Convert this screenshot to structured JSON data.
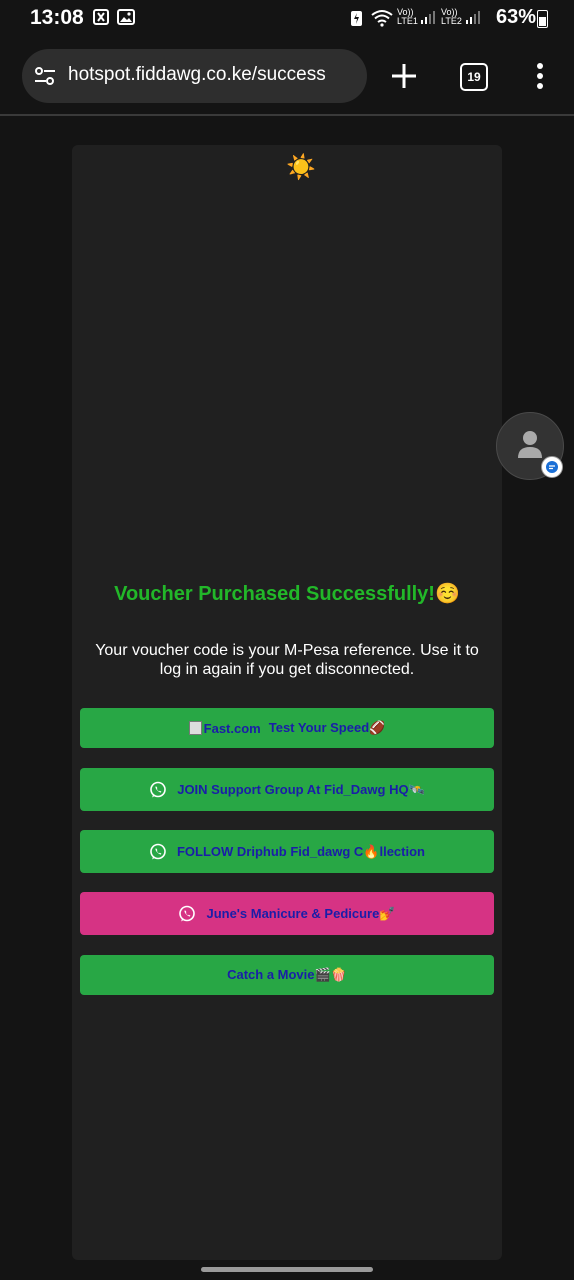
{
  "status": {
    "time": "13:08",
    "battery": "63%",
    "net1_top": "Vo))",
    "net1_bottom": "LTE1",
    "net2_top": "Vo))",
    "net2_bottom": "LTE2"
  },
  "browser": {
    "url": "hotspot.fiddawg.co.ke/success",
    "tab_count": "19"
  },
  "page": {
    "sun": "☀️",
    "heading": "Voucher Purchased Successfully!☺️",
    "message": "Your voucher code is your M-Pesa reference. Use it to log in again if you get disconnected.",
    "buttons": [
      {
        "alt": "Fast.com",
        "label": "Test Your Speed🏈"
      },
      {
        "label": "JOIN Support Group At Fid_Dawg HQ🛰️"
      },
      {
        "label": "FOLLOW Driphub Fid_dawg C🔥llection"
      },
      {
        "label": "June's Manicure & Pedicure💅"
      },
      {
        "label": "Catch a Movie🎬🍿"
      }
    ]
  },
  "colors": {
    "green": "#28a745",
    "pink": "#d63384",
    "heading_green": "#22b829",
    "link_blue": "#1a1ea8"
  }
}
